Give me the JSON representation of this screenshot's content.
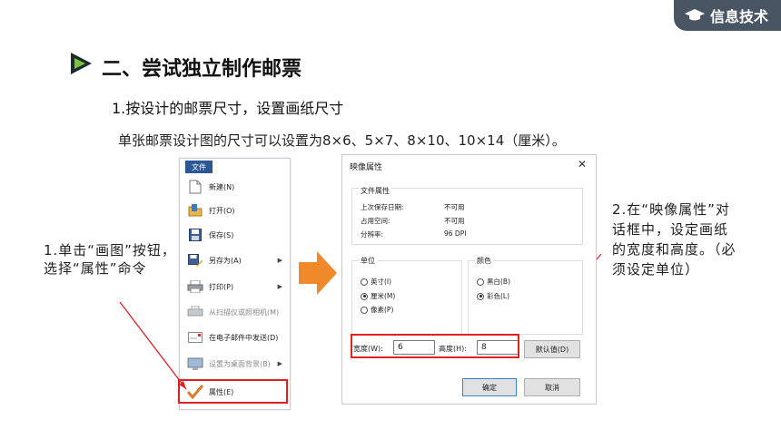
{
  "header": {
    "badge_text": "信息技术"
  },
  "section": {
    "title": "二、尝试独立制作邮票"
  },
  "subsection": {
    "title": "1.按设计的邮票尺寸，设置画纸尺寸"
  },
  "body": {
    "text": "单张邮票设计图的尺寸可以设置为8×6、5×7、8×10、10×14（厘米）。"
  },
  "menu": {
    "tab": "文件",
    "items": [
      {
        "label": "新建(N)",
        "icon": "new-file-icon",
        "disabled": false,
        "submenu": false
      },
      {
        "label": "打开(O)",
        "icon": "open-folder-icon",
        "disabled": false,
        "submenu": false
      },
      {
        "label": "保存(S)",
        "icon": "save-icon",
        "disabled": false,
        "submenu": false
      },
      {
        "label": "另存为(A)",
        "icon": "save-as-icon",
        "disabled": false,
        "submenu": true
      },
      {
        "label": "打印(P)",
        "icon": "printer-icon",
        "disabled": false,
        "submenu": true
      },
      {
        "label": "从扫描仪或照相机(M)",
        "icon": "scanner-icon",
        "disabled": true,
        "submenu": false
      },
      {
        "label": "在电子邮件中发送(D)",
        "icon": "email-icon",
        "disabled": false,
        "submenu": false
      },
      {
        "label": "设置为桌面背景(B)",
        "icon": "desktop-background-icon",
        "disabled": true,
        "submenu": true
      },
      {
        "label": "属性(E)",
        "icon": "checkmark-icon",
        "disabled": false,
        "submenu": false
      }
    ]
  },
  "annotations": {
    "left": "1.单击“画图”按钮，选择“属性”命令",
    "right": "2.在“映像属性”对话框中，设定画纸的宽度和高度。（必须设定单位）"
  },
  "dialog": {
    "title": "映像属性",
    "close": "✕",
    "file_props": {
      "label": "文件属性",
      "rows": [
        {
          "label": "上次保存日期:",
          "value": "不可用"
        },
        {
          "label": "占用空间:",
          "value": "不可用"
        },
        {
          "label": "分辨率:",
          "value": "96 DPI"
        }
      ]
    },
    "units": {
      "label": "单位",
      "options": [
        "英寸(I)",
        "厘米(M)",
        "像素(P)"
      ],
      "selected": "厘米(M)"
    },
    "colors": {
      "label": "颜色",
      "options": [
        "黑白(B)",
        "彩色(L)"
      ],
      "selected": "彩色(L)"
    },
    "width": {
      "label": "宽度(W):",
      "value": "6"
    },
    "height": {
      "label": "高度(H):",
      "value": "8"
    },
    "buttons": {
      "default": "默认值(D)",
      "ok": "确定",
      "cancel": "取消"
    }
  }
}
